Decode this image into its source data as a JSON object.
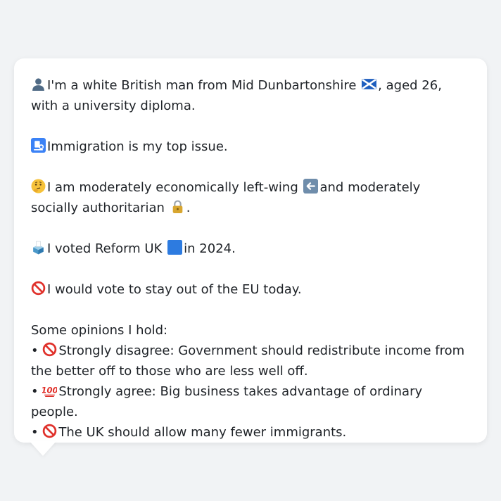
{
  "profile": {
    "intro_before_flag": "I'm a white British man from Mid Dunbartonshire",
    "intro_after_flag": ", aged 26, with a university diploma.",
    "top_issue": "Immigration is my top issue.",
    "position_part1": "I am moderately economically left-wing",
    "position_part2": "and moderately socially authoritarian",
    "position_end": ".",
    "vote_before": "I voted Reform UK",
    "vote_after": "in 2024.",
    "eu_view": "I would vote to stay out of the EU today."
  },
  "opinions": {
    "heading": "Some opinions I hold:",
    "bullet": "•",
    "items": [
      "Strongly disagree: Government should redistribute income from the better off to those who are less well off.",
      "Strongly agree: Big business takes advantage of ordinary people.",
      "The UK should allow many fewer immigrants."
    ]
  },
  "icons": {
    "person": "person-silhouette-icon",
    "scotland_flag": "scotland-flag-icon",
    "passport_control": "passport-control-icon",
    "thinking": "thinking-face-icon",
    "left_arrow": "left-arrow-icon",
    "lock": "lock-icon",
    "ballot_box": "ballot-box-icon",
    "blue_square": "blue-square-icon",
    "prohibited": "prohibited-icon",
    "hundred": "hundred-points-icon"
  },
  "colors": {
    "page_bg": "#f1f3f5",
    "bubble_bg": "#ffffff",
    "text": "#1f2328",
    "reform_blue": "#2d7be0",
    "prohibited_red": "#e0312b"
  }
}
